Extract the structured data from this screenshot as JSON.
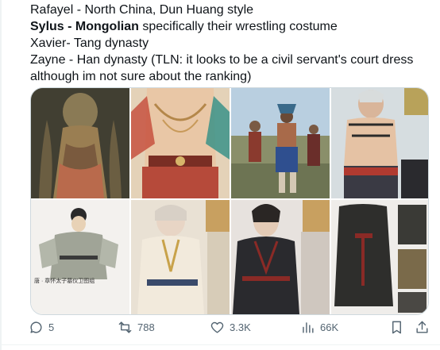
{
  "post": {
    "lines": [
      {
        "bold": "",
        "text": "Rafayel - North China, Dun Huang style"
      },
      {
        "bold": "Sylus - Mongolian",
        "text": " specifically their wrestling costume"
      },
      {
        "bold": "",
        "text": "Xavier- Tang dynasty"
      },
      {
        "bold": "",
        "text": "Zayne - Han dynasty  (TLN: it looks to be a civil servant's court dress although im not sure about the ranking)"
      }
    ]
  },
  "media": {
    "tiles": [
      "dunhuang-statue-photo",
      "character-dunhuang-costume",
      "mongolian-wrestlers-photo",
      "character-mongolian-costume",
      "tang-official-illustration",
      "character-tang-costume",
      "character-han-costume",
      "han-court-robe-photo"
    ],
    "caption_tang": "唐 · 章怀太子墓仪卫图组"
  },
  "actions": {
    "reply_count": "5",
    "repost_count": "788",
    "like_count": "3.3K",
    "view_count": "66K"
  },
  "colors": {
    "text": "#0f1419",
    "muted": "#536471",
    "border": "#cfd9de"
  }
}
